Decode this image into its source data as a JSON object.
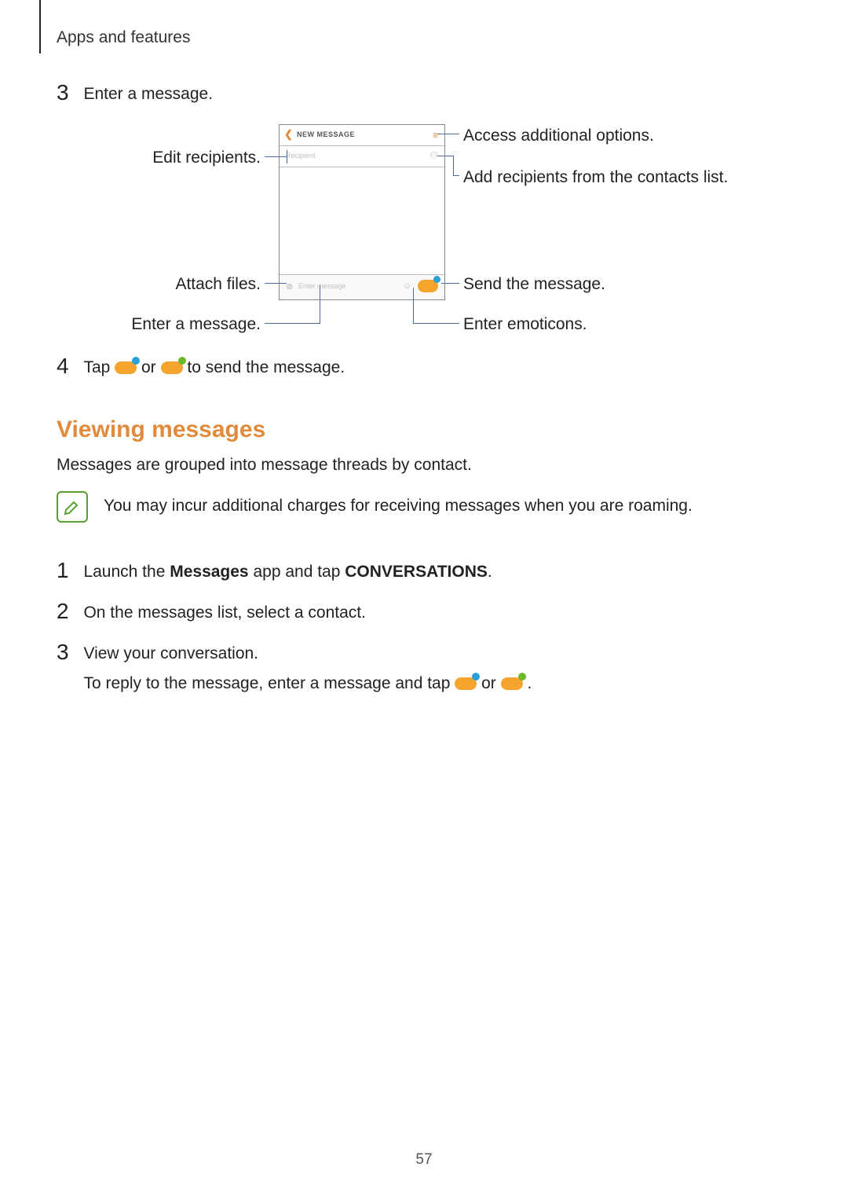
{
  "header": {
    "breadcrumb": "Apps and features"
  },
  "step3": {
    "num": "3",
    "text": "Enter a message."
  },
  "figure": {
    "phone": {
      "title": "NEW MESSAGE",
      "recipient_placeholder": "Recipient",
      "enter_placeholder": "Enter message"
    },
    "callouts": {
      "edit_recipients": "Edit recipients.",
      "attach_files": "Attach files.",
      "enter_message": "Enter a message.",
      "access_options": "Access additional options.",
      "add_contacts": "Add recipients from the contacts list.",
      "send_message": "Send the message.",
      "enter_emoticons": "Enter emoticons."
    }
  },
  "step4": {
    "num": "4",
    "pre": "Tap ",
    "mid": " or ",
    "post": " to send the message."
  },
  "section": {
    "title": "Viewing messages"
  },
  "intro": "Messages are grouped into message threads by contact.",
  "note": "You may incur additional charges for receiving messages when you are roaming.",
  "v1": {
    "num": "1",
    "pre": "Launch the ",
    "app": "Messages",
    "mid": " app and tap ",
    "tab": "CONVERSATIONS",
    "post": "."
  },
  "v2": {
    "num": "2",
    "text": "On the messages list, select a contact."
  },
  "v3": {
    "num": "3",
    "text": "View your conversation.",
    "sub_pre": "To reply to the message, enter a message and tap ",
    "sub_mid": " or ",
    "sub_post": "."
  },
  "page_number": "57"
}
